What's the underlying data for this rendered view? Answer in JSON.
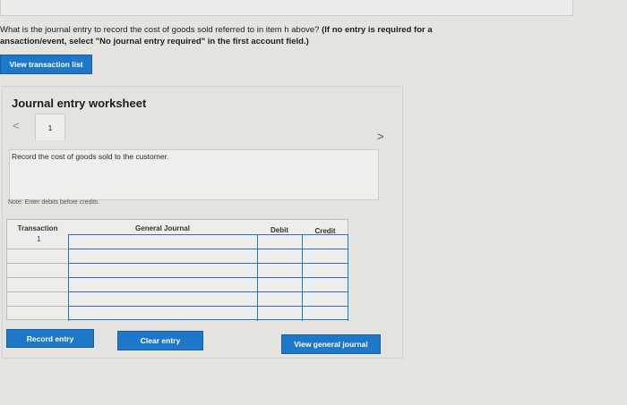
{
  "question": {
    "line1": "What is the journal entry to record the cost of goods sold referred to in item h above?",
    "line1_bold": " (If no entry is required for a",
    "line2_bold": "ansaction/event, select \"No journal entry required\" in the first account field.)"
  },
  "buttons": {
    "view_transaction_list": "View transaction list",
    "record_entry": "Record entry",
    "clear_entry": "Clear entry",
    "view_general_journal": "View general journal"
  },
  "worksheet": {
    "title": "Journal entry worksheet",
    "prev": "<",
    "next": ">",
    "tab_number": "1",
    "instruction": "Record the cost of goods sold to the customer.",
    "note": "Note: Enter debits before credits."
  },
  "table": {
    "headers": [
      "Transaction",
      "General Journal",
      "Debit",
      "Credit"
    ],
    "first_row_number": "1"
  },
  "colors": {
    "accent": "#1e78c9",
    "background": "#e6e4e1"
  }
}
